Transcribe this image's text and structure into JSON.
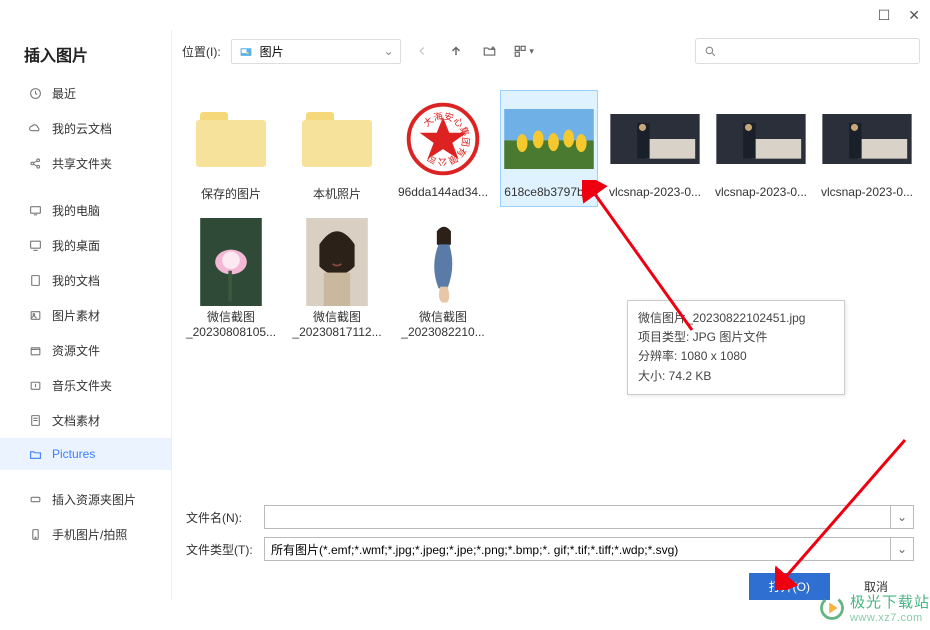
{
  "window": {
    "win_titlebar_min": "—",
    "win_titlebar_max": "☐",
    "win_titlebar_close": "✕"
  },
  "sidebar": {
    "title": "插入图片",
    "items": [
      {
        "label": "最近",
        "icon": "clock-icon"
      },
      {
        "label": "我的云文档",
        "icon": "cloud-icon"
      },
      {
        "label": "共享文件夹",
        "icon": "share-icon"
      },
      {
        "label": "我的电脑",
        "icon": "monitor-icon"
      },
      {
        "label": "我的桌面",
        "icon": "desktop-icon"
      },
      {
        "label": "我的文档",
        "icon": "document-icon"
      },
      {
        "label": "图片素材",
        "icon": "image-icon"
      },
      {
        "label": "资源文件",
        "icon": "box-icon"
      },
      {
        "label": "音乐文件夹",
        "icon": "music-icon"
      },
      {
        "label": "文档素材",
        "icon": "doc-icon"
      },
      {
        "label": "Pictures",
        "icon": "folder-icon"
      },
      {
        "label": "插入资源夹图片",
        "icon": "link-icon"
      },
      {
        "label": "手机图片/拍照",
        "icon": "phone-icon"
      }
    ]
  },
  "toolbar": {
    "location_label": "位置(I):",
    "location_value": "图片",
    "back_icon": "←",
    "up_icon": "↑",
    "newfolder_icon": "⊞",
    "view_icon": "⊟"
  },
  "files": [
    {
      "name": "保存的图片",
      "type": "folder"
    },
    {
      "name": "本机照片",
      "type": "folder"
    },
    {
      "name": "96dda144ad34...",
      "type": "stamp"
    },
    {
      "name": "618ce8b3797b...",
      "type": "tulips",
      "selected": true
    },
    {
      "name": "vlcsnap-2023-0...",
      "type": "video1"
    },
    {
      "name": "vlcsnap-2023-0...",
      "type": "video1"
    },
    {
      "name": "vlcsnap-2023-0...",
      "type": "video1"
    },
    {
      "name1": "微信截图",
      "name2": "_20230808105...",
      "type": "lotus"
    },
    {
      "name1": "微信截图",
      "name2": "_20230817112...",
      "type": "portrait"
    },
    {
      "name1": "微信截图",
      "name2": "_2023082210...",
      "type": "figure"
    }
  ],
  "tooltip": {
    "l1": "微信图片_20230822102451.jpg",
    "l2": "项目类型: JPG 图片文件",
    "l3": "分辨率: 1080 x 1080",
    "l4": "大小: 74.2 KB"
  },
  "bottom": {
    "filename_label": "文件名(N):",
    "filename_value": "",
    "filetype_label": "文件类型(T):",
    "filetype_value": "所有图片(*.emf;*.wmf;*.jpg;*.jpeg;*.jpe;*.png;*.bmp;*. gif;*.tif;*.tiff;*.wdp;*.svg)",
    "open": "打开(O)",
    "cancel": "取消"
  },
  "watermark": {
    "t1": "极光下载站",
    "t2": "www.xz7.com"
  }
}
